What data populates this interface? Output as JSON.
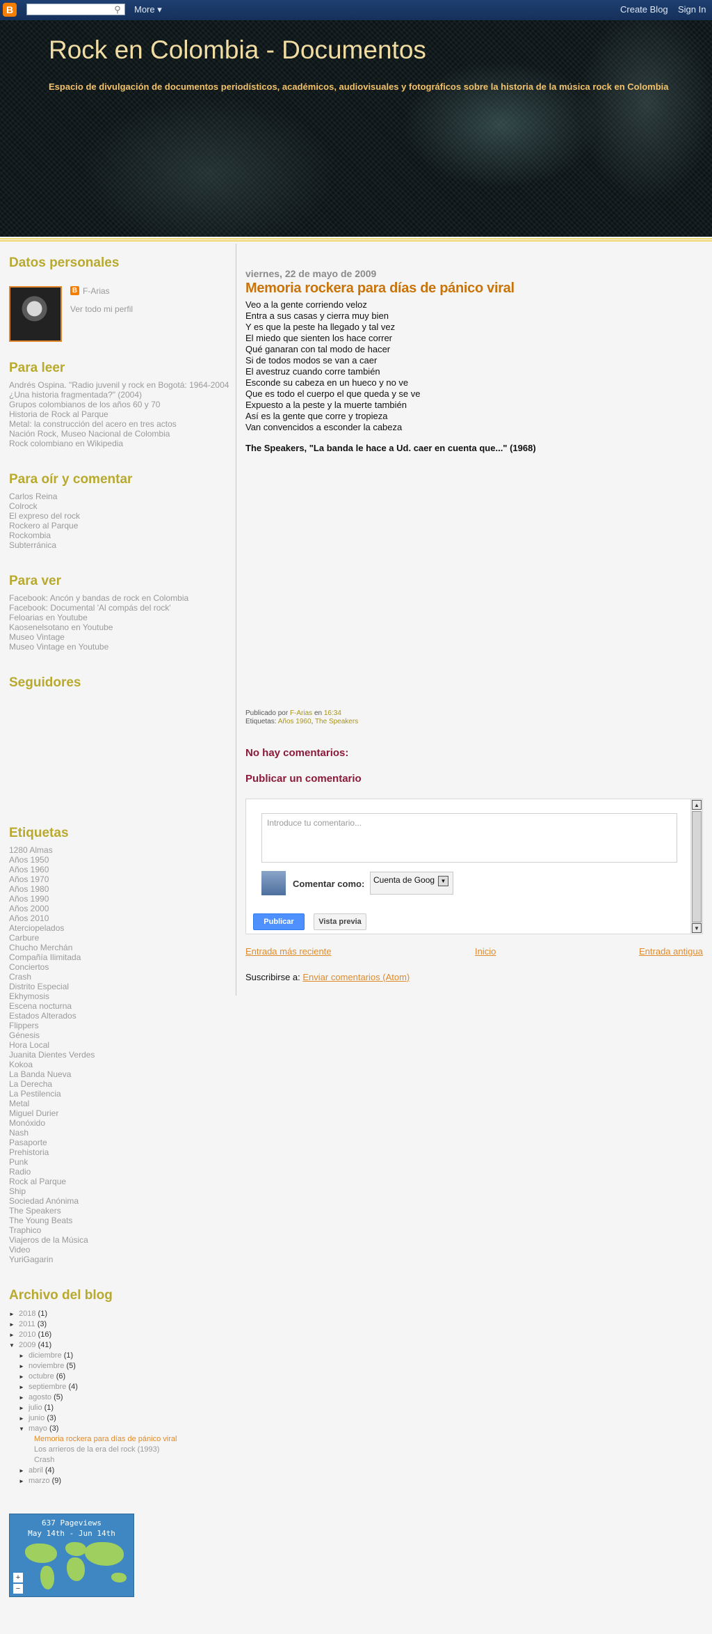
{
  "navbar": {
    "logo": "B",
    "search_value": "",
    "more_label": "More ▾",
    "create_blog": "Create Blog",
    "sign_in": "Sign In"
  },
  "header": {
    "title": "Rock en Colombia - Documentos",
    "description": "Espacio de divulgación de documentos periodísticos, académicos, audiovisuales y fotográficos sobre la historia de la música rock en Colombia"
  },
  "sidebar": {
    "profile": {
      "title": "Datos personales",
      "name": "F-Arias",
      "view_profile": "Ver todo mi perfil"
    },
    "para_leer": {
      "title": "Para leer",
      "links": [
        "Andrés Ospina. \"Radio juvenil y rock en Bogotá: 1964-2004 ¿Una historia fragmentada?\" (2004)",
        "Grupos colombianos de los años 60 y 70",
        "Historia de Rock al Parque",
        "Metal: la construcción del acero en tres actos",
        "Nación Rock, Museo Nacional de Colombia",
        "Rock colombiano en Wikipedia"
      ]
    },
    "para_oir": {
      "title": "Para oír y comentar",
      "links": [
        "Carlos Reina",
        "Colrock",
        "El expreso del rock",
        "Rockero al Parque",
        "Rockombia",
        "Subterránica"
      ]
    },
    "para_ver": {
      "title": "Para ver",
      "links": [
        "Facebook: Ancón y bandas de rock en Colombia",
        "Facebook: Documental 'Al compás del rock'",
        "Feloarias en Youtube",
        "Kaosenelsotano en Youtube",
        "Museo Vintage",
        "Museo Vintage en Youtube"
      ]
    },
    "seguidores": {
      "title": "Seguidores"
    },
    "etiquetas": {
      "title": "Etiquetas",
      "links": [
        "1280 Almas",
        "Años 1950",
        "Años 1960",
        "Años 1970",
        "Años 1980",
        "Años 1990",
        "Años 2000",
        "Años 2010",
        "Aterciopelados",
        "Carbure",
        "Chucho Merchán",
        "Compañía Ilimitada",
        "Conciertos",
        "Crash",
        "Distrito Especial",
        "Ekhymosis",
        "Escena nocturna",
        "Estados Alterados",
        "Flippers",
        "Génesis",
        "Hora Local",
        "Juanita Dientes Verdes",
        "Kokoa",
        "La Banda Nueva",
        "La Derecha",
        "La Pestilencia",
        "Metal",
        "Miguel Durier",
        "Monóxido",
        "Nash",
        "Pasaporte",
        "Prehistoria",
        "Punk",
        "Radio",
        "Rock al Parque",
        "Ship",
        "Sociedad Anónima",
        "The Speakers",
        "The Young Beats",
        "Traphico",
        "Viajeros de la Música",
        "Video",
        "YuriGagarin"
      ]
    },
    "archivo": {
      "title": "Archivo del blog",
      "years": [
        {
          "tri": "►",
          "label": "2018",
          "count": "(1)"
        },
        {
          "tri": "►",
          "label": "2011",
          "count": "(3)"
        },
        {
          "tri": "►",
          "label": "2010",
          "count": "(16)"
        },
        {
          "tri": "▼",
          "label": "2009",
          "count": "(41)"
        }
      ],
      "months_before": [
        {
          "tri": "►",
          "label": "diciembre",
          "count": "(1)"
        },
        {
          "tri": "►",
          "label": "noviembre",
          "count": "(5)"
        },
        {
          "tri": "►",
          "label": "octubre",
          "count": "(6)"
        },
        {
          "tri": "►",
          "label": "septiembre",
          "count": "(4)"
        },
        {
          "tri": "►",
          "label": "agosto",
          "count": "(5)"
        },
        {
          "tri": "►",
          "label": "julio",
          "count": "(1)"
        },
        {
          "tri": "►",
          "label": "junio",
          "count": "(3)"
        },
        {
          "tri": "▼",
          "label": "mayo",
          "count": "(3)"
        }
      ],
      "posts": [
        "Memoria rockera para días de pánico viral",
        "Los arrieros de la era del rock (1993)",
        "Crash"
      ],
      "months_after": [
        {
          "tri": "►",
          "label": "abril",
          "count": "(4)"
        },
        {
          "tri": "►",
          "label": "marzo",
          "count": "(9)"
        }
      ]
    },
    "map": {
      "line1": "637 Pageviews",
      "line2": "May 14th - Jun 14th",
      "zoom_in": "+",
      "zoom_out": "−"
    }
  },
  "post": {
    "date": "viernes, 22 de mayo de 2009",
    "title": "Memoria rockera para días de pánico viral",
    "lines": [
      "Veo a la gente corriendo veloz",
      "Entra a sus casas y cierra muy bien",
      "Y es que la peste ha llegado y tal vez",
      "El miedo que sienten los hace correr",
      "Qué ganaran con tal modo de hacer",
      "Si de todos modos se van a caer",
      "El avestruz cuando corre también",
      "Esconde su cabeza en un hueco y no ve",
      "Que es todo el cuerpo el que queda y se ve",
      "Expuesto a la peste y la muerte también",
      "Así es la gente que corre y tropieza",
      "Van convencidos a esconder la cabeza"
    ],
    "caption": "The Speakers, \"La banda le hace a Ud. caer en cuenta que...\" (1968)",
    "published_by": "Publicado por",
    "author": "F-Arias",
    "at": "en",
    "time": "16:34",
    "labels_prefix": "Etiquetas:",
    "label1": "Años 1960",
    "label2": "The Speakers"
  },
  "comments": {
    "none": "No hay comentarios:",
    "publish_title": "Publicar un comentario",
    "placeholder": "Introduce tu comentario...",
    "comment_as": "Comentar como:",
    "account": "Cuenta de Goog",
    "publish_button": "Publicar",
    "preview_button": "Vista previa"
  },
  "pager": {
    "newer": "Entrada más reciente",
    "home": "Inicio",
    "older": "Entrada antigua"
  },
  "subscribe": {
    "prefix": "Suscribirse a:",
    "link": "Enviar comentarios (Atom)"
  }
}
